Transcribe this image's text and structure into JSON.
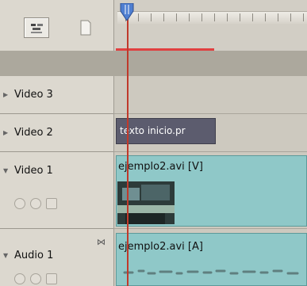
{
  "tracks": [
    {
      "label": "Video 3"
    },
    {
      "label": "Video 2"
    },
    {
      "label": "Video 1"
    },
    {
      "label": "Audio 1"
    }
  ],
  "clips": {
    "title_clip": "texto inicio.pr",
    "video_clip": "ejemplo2.avi [V]",
    "audio_clip": "ejemplo2.avi [A]"
  },
  "icons": {
    "snap": "snap-icon",
    "marker": "marker-icon",
    "playhead": "playhead-icon"
  },
  "colors": {
    "clip_fill": "#8fc8c8",
    "title_clip_fill": "#5c5c6e",
    "playhead": "#c0392b",
    "work_area": "#e04040"
  }
}
